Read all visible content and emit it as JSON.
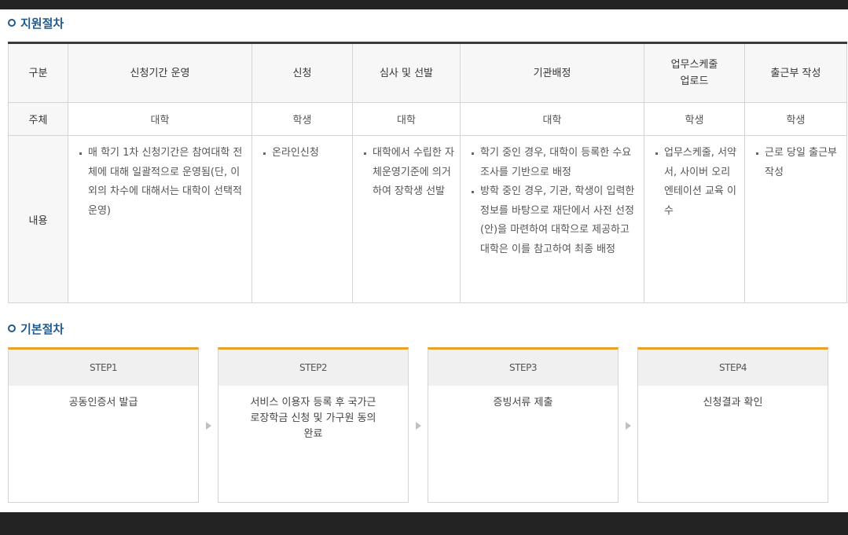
{
  "sections": {
    "support_title": "지원절차",
    "basic_title": "기본절차"
  },
  "table": {
    "headers": [
      "구분",
      "신청기간 운영",
      "신청",
      "심사 및 선발",
      "기관배정",
      "업무스케줄 업로드",
      "출근부 작성"
    ],
    "subject_label": "주체",
    "subjects": [
      "대학",
      "학생",
      "대학",
      "대학",
      "학생",
      "학생"
    ],
    "content_label": "내용",
    "contents": [
      [
        "매 학기 1차 신청기간은 참여대학 전체에 대해 일괄적으로 운영됨(단, 이외의 차수에 대해서는 대학이 선택적 운영)"
      ],
      [
        "온라인신청"
      ],
      [
        "대학에서 수립한 자체운영기준에 의거하여 장학생 선발"
      ],
      [
        "학기 중인 경우, 대학이 등록한 수요조사를 기반으로 배정",
        "방학 중인 경우, 기관, 학생이 입력한 정보를 바탕으로 재단에서 사전 선정(안)을 마련하여 대학으로 제공하고 대학은 이를 참고하여 최종 배정"
      ],
      [
        "업무스케줄, 서약서, 사이버 오리엔테이션 교육 이수"
      ],
      [
        "근로 당일 출근부 작성"
      ]
    ]
  },
  "steps": [
    {
      "label": "STEP1",
      "text": "공동인증서 발급"
    },
    {
      "label": "STEP2",
      "text": "서비스 이용자 등록 후 국가근로장학금 신청 및 가구원 동의완료"
    },
    {
      "label": "STEP3",
      "text": "증빙서류 제출"
    },
    {
      "label": "STEP4",
      "text": "신청결과 확인"
    }
  ],
  "colors": {
    "section_title": "#1e5c8f",
    "step_accent": "#e8a227",
    "table_top_border": "#3a3a3a"
  }
}
